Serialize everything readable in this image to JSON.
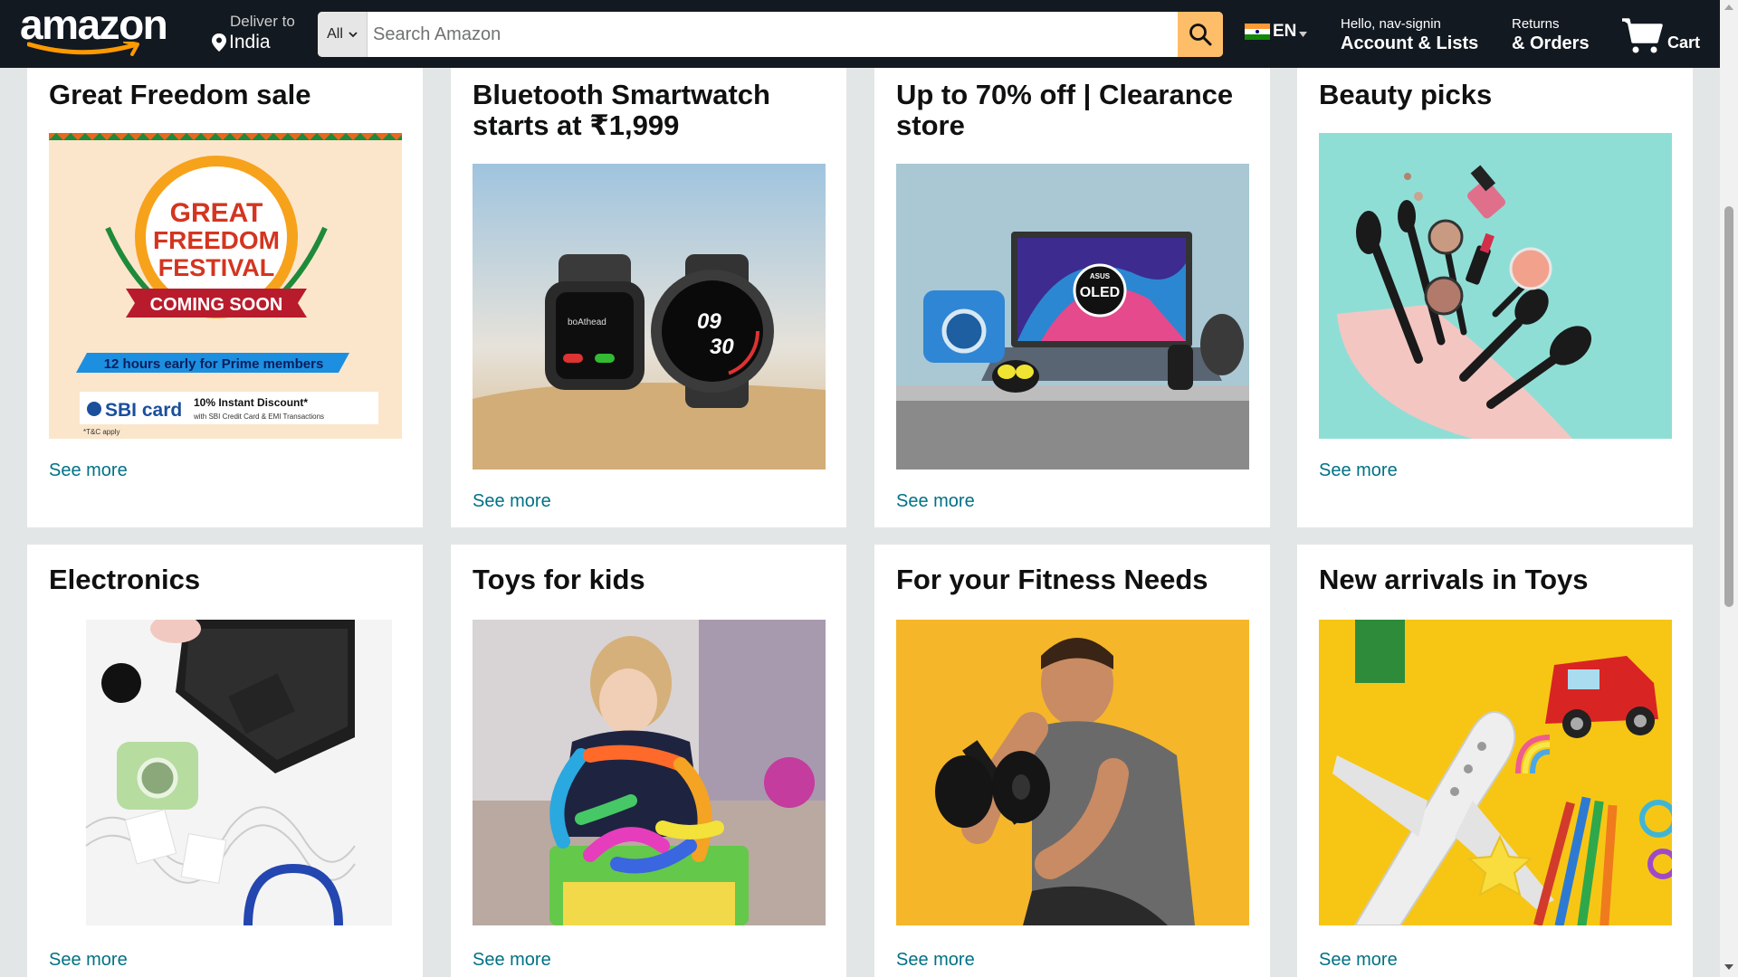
{
  "nav": {
    "logo_text": "amazon",
    "deliver_label": "Deliver to",
    "deliver_location": "India",
    "search_category": "All",
    "search_placeholder": "Search Amazon",
    "language": "EN",
    "account_greeting": "Hello, nav-signin",
    "account_label": "Account & Lists",
    "returns_label": "Returns",
    "orders_label": "& Orders",
    "cart_label": "Cart"
  },
  "colors": {
    "nav_bg": "#131921",
    "search_button": "#febd69",
    "link": "#007185",
    "page_bg": "#e3e6e6"
  },
  "cards": [
    {
      "title": "Great Freedom sale",
      "link": "See more",
      "image": "great-freedom-festival-banner"
    },
    {
      "title": "Bluetooth Smartwatch starts at ₹1,999",
      "link": "See more",
      "image": "smartwatches-on-sand"
    },
    {
      "title": "Up to 70% off | Clearance store",
      "link": "See more",
      "image": "laptop-camera-earbuds"
    },
    {
      "title": "Beauty picks",
      "link": "See more",
      "image": "makeup-brushes-pouch"
    },
    {
      "title": "Electronics",
      "link": "See more",
      "image": "laptop-camera-headphones"
    },
    {
      "title": "Toys for kids",
      "link": "See more",
      "image": "child-playing-tubes"
    },
    {
      "title": "For your Fitness Needs",
      "link": "See more",
      "image": "man-lifting-dumbbell"
    },
    {
      "title": "New arrivals in Toys",
      "link": "See more",
      "image": "toy-plane-car-pencils"
    }
  ],
  "banner_text": {
    "line1": "GREAT",
    "line2": "FREEDOM",
    "line3": "FESTIVAL",
    "ribbon": "COMING SOON",
    "prime_note": "12 hours early for Prime members",
    "sbi_logo": "SBI card",
    "discount": "10% Instant Discount*",
    "discount_sub": "with SBI Credit Card & EMI Transactions",
    "tnc": "*T&C apply"
  },
  "watch_text": {
    "brand": "boAthead",
    "hour": "09",
    "minute": "30"
  },
  "laptop_text": {
    "brand": "ASUS",
    "oled": "OLED"
  }
}
